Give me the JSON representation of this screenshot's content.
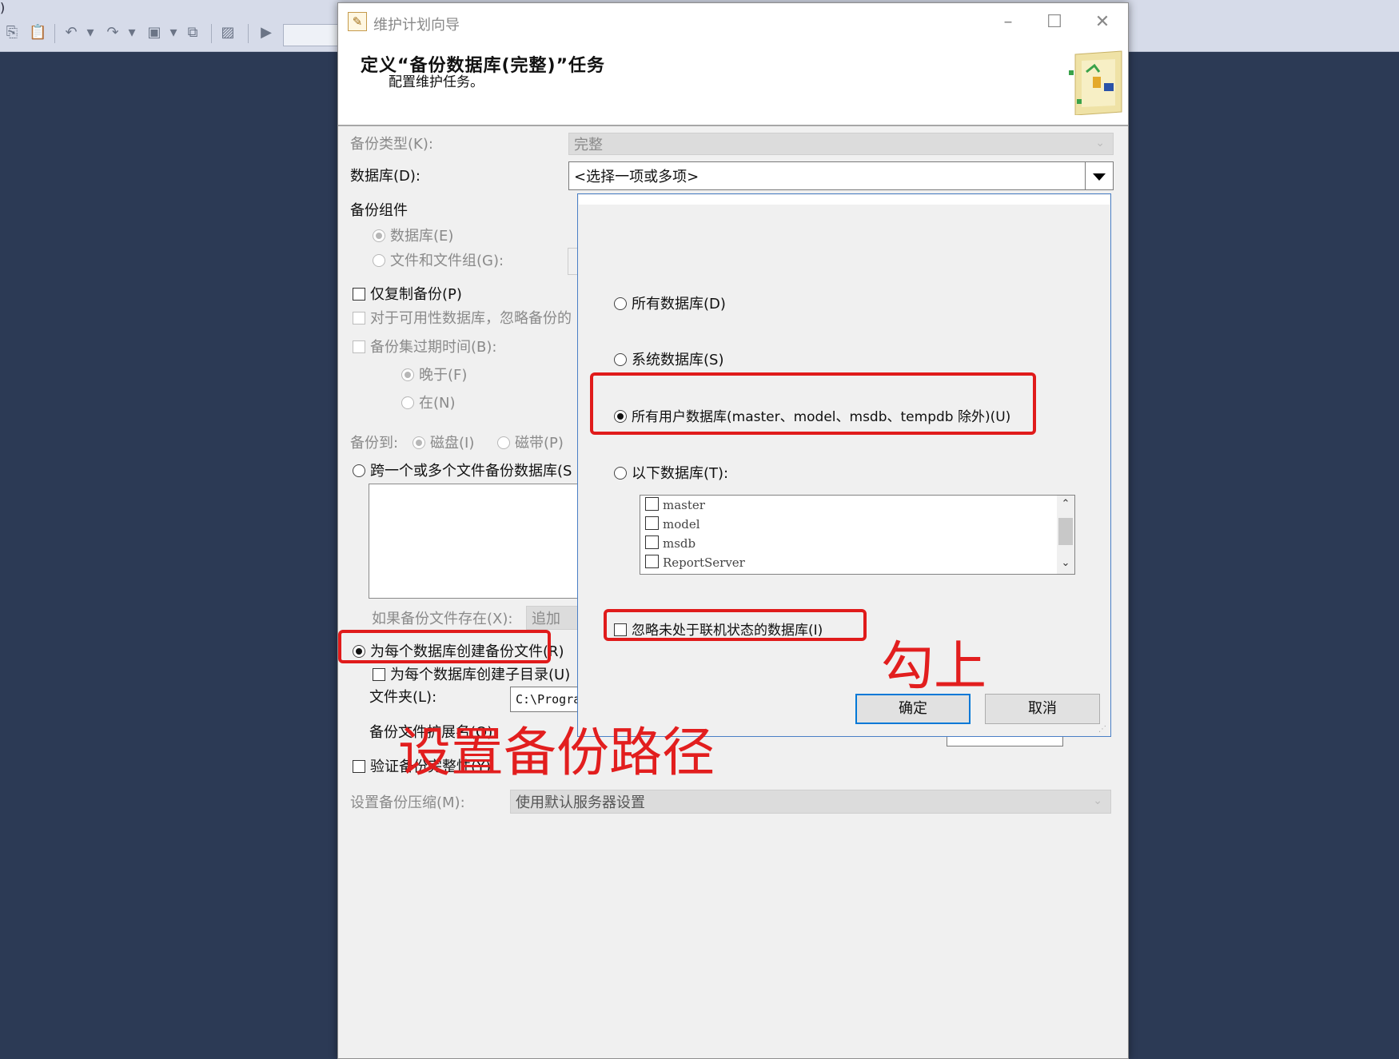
{
  "background_toolbar": {
    "fragment": ")"
  },
  "dialog": {
    "title": "维护计划向导",
    "header_title": "定义“备份数据库(完整)”任务",
    "header_subtitle": "配置维护任务。"
  },
  "form": {
    "backup_type_label": "备份类型(K):",
    "backup_type_value": "完整",
    "database_label": "数据库(D):",
    "database_value": "<选择一项或多项>",
    "components_label": "备份组件",
    "comp_database": "数据库(E)",
    "comp_files": "文件和文件组(G):",
    "copy_only": "仅复制备份(P)",
    "availability_ignore": "对于可用性数据库，忽略备份的",
    "expire_label": "备份集过期时间(B):",
    "expire_after": "晚于(F)",
    "expire_on": "在(N)",
    "backup_to_label": "备份到:",
    "backup_to_disk": "磁盘(I)",
    "backup_to_tape": "磁带(P)",
    "span_files": "跨一个或多个文件备份数据库(S",
    "if_exists_label": "如果备份文件存在(X):",
    "if_exists_value": "追加",
    "per_db_file": "为每个数据库创建备份文件(R)",
    "per_db_subdir": "为每个数据库创建子目录(U)",
    "folder_label": "文件夹(L):",
    "folder_value": "C:\\Progra",
    "extension_label": "备份文件扩展名(O):",
    "verify": "验证备份完整性(Y)",
    "compression_label": "设置备份压缩(M):",
    "compression_value": "使用默认服务器设置"
  },
  "popup": {
    "all_databases": "所有数据库(D)",
    "system_databases": "系统数据库(S)",
    "all_user_databases": "所有用户数据库(master、model、msdb、tempdb 除外)(U)",
    "these_databases": "以下数据库(T):",
    "databases": [
      "master",
      "model",
      "msdb",
      "ReportServer"
    ],
    "ignore_offline": "忽略未处于联机状态的数据库(I)",
    "ok": "确定",
    "cancel": "取消"
  },
  "annotations": {
    "check_it": "勾上",
    "set_path": "设置备份路径",
    "color": "#e01b1b"
  }
}
